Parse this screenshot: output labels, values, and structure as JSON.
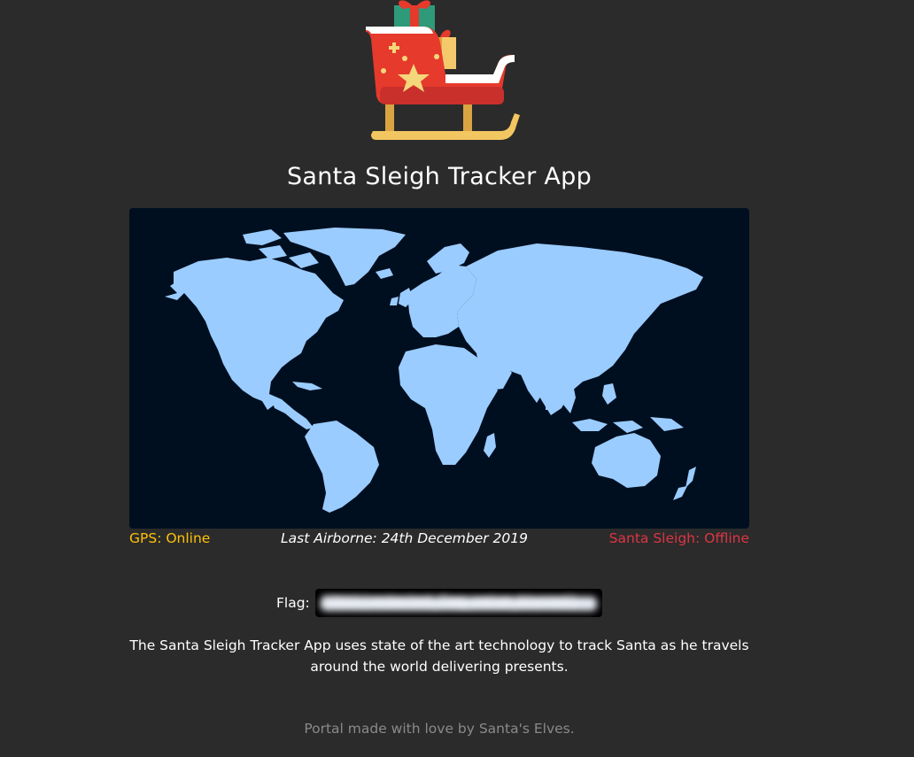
{
  "header": {
    "logo_icon": "sleigh-with-presents-icon",
    "title": "Santa Sleigh Tracker App"
  },
  "map": {
    "icon": "world-map",
    "land_color": "#9bccff",
    "sea_color": "#000f20"
  },
  "status": {
    "gps": "GPS: Online",
    "gps_color": "#ffc107",
    "last_airborne": "Last Airborne: 24th December 2019",
    "sleigh": "Santa Sleigh: Offline",
    "sleigh_color": "#dc3545"
  },
  "flag": {
    "label": "Flag:",
    "value": "XMAS{redacted_flag_value_blurred}"
  },
  "description": "The Santa Sleigh Tracker App uses state of the art technology to track Santa as he travels around the world delivering presents.",
  "footer": "Portal made with love by Santa's Elves."
}
